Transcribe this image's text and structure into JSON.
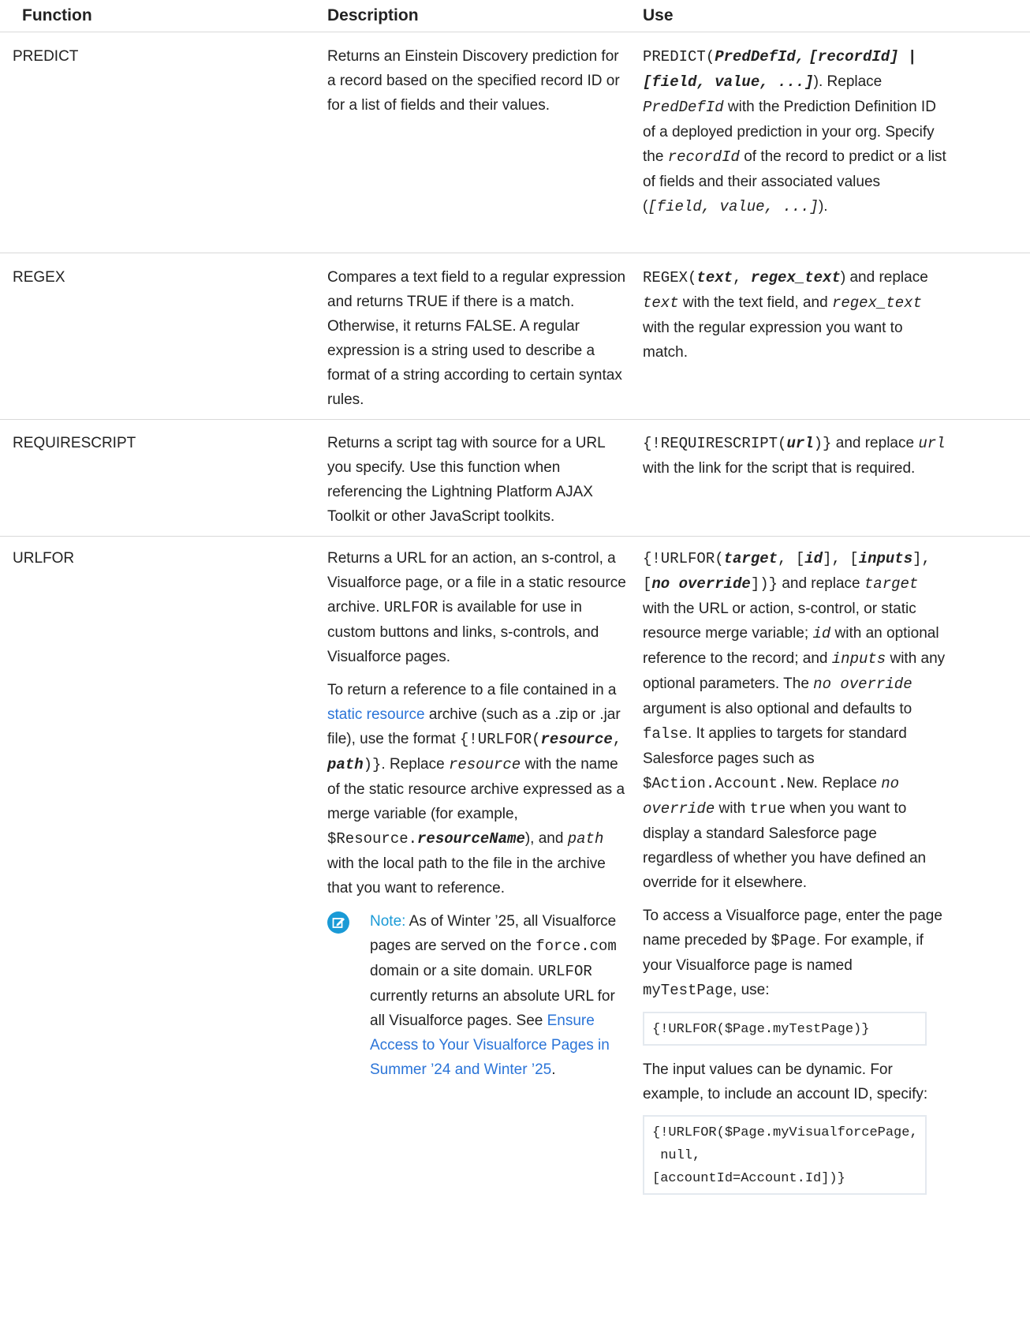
{
  "header": {
    "function": "Function",
    "description": "Description",
    "use": "Use"
  },
  "rows": [
    {
      "function": "PREDICT",
      "description": "Returns an Einstein Discovery prediction for a record based on the specified record ID or for a list of fields and their values.",
      "use": {
        "t1": "PREDICT(",
        "t2": "PredDefId,",
        "t3": "[recordId] | [field, value, ...]",
        "t4": "). Replace ",
        "t5": "PredDefId",
        "t6": " with the Prediction Definition ID of a deployed prediction in your org. Specify the ",
        "t7": "recordId",
        "t8": " of the record to predict or a list of fields and their associated values (",
        "t9": "[field, value, ...]",
        "t10": ")."
      }
    },
    {
      "function": "REGEX",
      "description": "Compares a text field to a regular expression and returns TRUE if there is a match. Otherwise, it returns FALSE. A regular expression is a string used to describe a format of a string according to certain syntax rules.",
      "use": {
        "t1": "REGEX(",
        "t2": "text",
        "t3": ", ",
        "t4": "regex_text",
        "t5": ") and replace ",
        "t6": "text",
        "t7": " with the text field, and ",
        "t8": "regex_text",
        "t9": " with the regular expression you want to match."
      }
    },
    {
      "function": "REQUIRESCRIPT",
      "description": "Returns a script tag with source for a URL you specify. Use this function when referencing the Lightning Platform AJAX Toolkit or other JavaScript toolkits.",
      "use": {
        "t1": "{!REQUIRESCRIPT(",
        "t2": "url",
        "t3": ")}",
        "t4": " and replace ",
        "t5": "url",
        "t6": " with the link for the script that is required."
      }
    },
    {
      "function": "URLFOR",
      "description": {
        "p1a": "Returns a URL for an action, an s-control, a Visualforce page, or a file in a static resource archive. ",
        "p1b": "URLFOR",
        "p1c": " is available for use in custom buttons and links, s-controls, and Visualforce pages.",
        "p2a": "To return a reference to a file contained in a ",
        "p2link": "static resource",
        "p2b": " archive (such as a .zip or .jar file), use the format ",
        "p2c": "{!URLFOR(",
        "p2d": "resource",
        "p2e": ", ",
        "p2f": "path",
        "p2g": ")}",
        "p2h": ". Replace ",
        "p2i": "resource",
        "p2j": " with the name of the static resource archive expressed as a merge variable (for example, ",
        "p2k": "$Resource.",
        "p2l": "resourceName",
        "p2m": "), and ",
        "p2n": "path",
        "p2o": " with the local path to the file in the archive that you want to reference.",
        "note_title": "Note:",
        "note_a": " As of Winter ’25, all Visualforce pages are served on the ",
        "note_b": "force.com",
        "note_c": " domain or a site domain. ",
        "note_d": "URLFOR",
        "note_e": " currently returns an absolute URL for all Visualforce pages. See ",
        "note_link": "Ensure Access to Your Visualforce Pages in Summer ’24 and Winter ’25",
        "note_f": "."
      },
      "use": {
        "u1": "{!URLFOR(",
        "u2": "target",
        "u3": ", [",
        "u4": "id",
        "u5": "], [",
        "u6": "inputs",
        "u7": "], [",
        "u8": "no override",
        "u9": "])}",
        "u10": " and replace ",
        "u11": "target",
        "u12": " with the URL or action, s-control, or static resource merge variable; ",
        "u13": "id",
        "u14": " with an optional reference to the record; and ",
        "u15": "inputs",
        "u16": " with any optional parameters. The ",
        "u17": "no override",
        "u18": " argument is also optional and defaults to ",
        "u19": "false",
        "u20": ". It applies to targets for standard Salesforce pages such as ",
        "u21": "$Action.Account.New",
        "u22": ". Replace ",
        "u23": "no override",
        "u24": " with ",
        "u25": "true",
        "u26": " when you want to display a standard Salesforce page regardless of whether you have defined an override for it elsewhere.",
        "v1": "To access a Visualforce page, enter the page name preceded by ",
        "v2": "$Page",
        "v3": ". For example, if your Visualforce page is named ",
        "v4": "myTestPage",
        "v5": ", use:",
        "code1": "{!URLFOR($Page.myTestPage)}",
        "w1": "The input values can be dynamic. For example, to include an account ID, specify:",
        "code2_l1": "{!URLFOR($Page.myVisualforcePage,",
        "code2_l2": " null,",
        "code2_l3": "[accountId=Account.Id])}"
      }
    }
  ]
}
